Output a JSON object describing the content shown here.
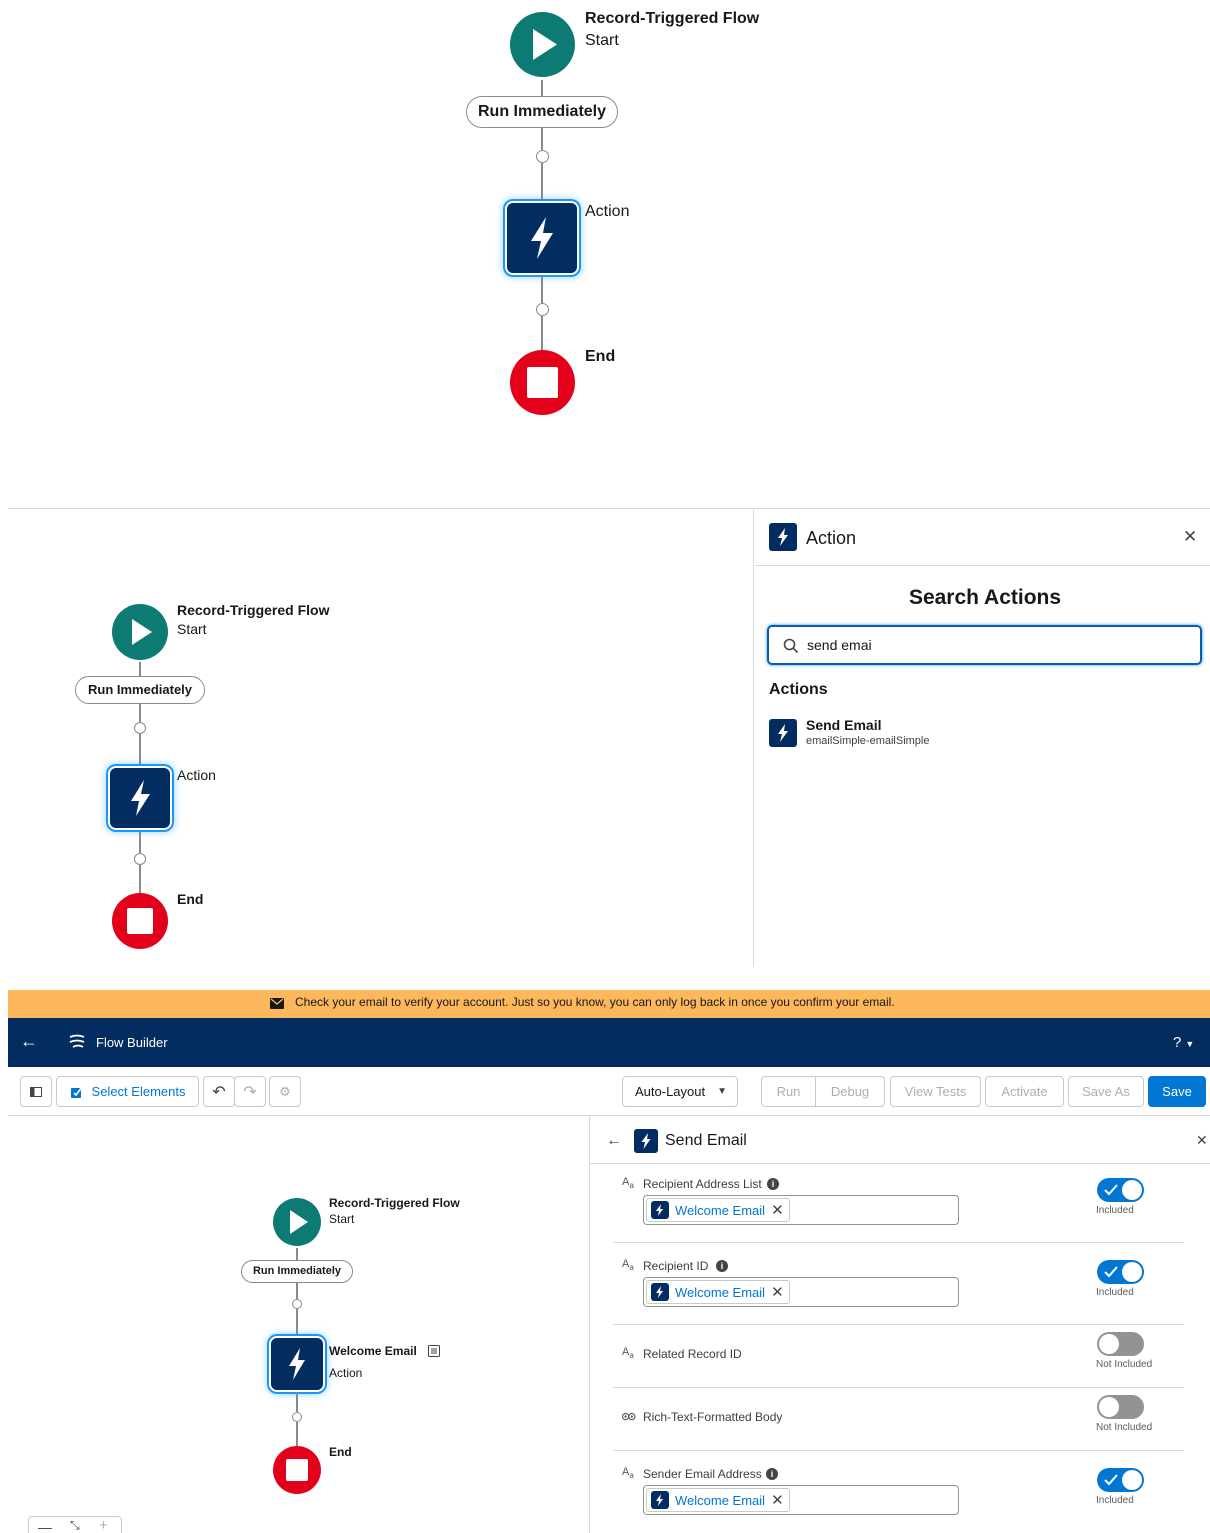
{
  "flow": {
    "start_title": "Record-Triggered Flow",
    "start_sub": "Start",
    "run_immediately": "Run Immediately",
    "action_label": "Action",
    "end_label": "End",
    "action_named": "Welcome Email"
  },
  "action_panel": {
    "title": "Action",
    "close": "✕",
    "search_heading": "Search Actions",
    "search_value": "send emai",
    "section": "Actions",
    "result_name": "Send Email",
    "result_api": "emailSimple-emailSimple"
  },
  "banner": {
    "text": "Check your email to verify your account. Just so you know, you can only log back in once you confirm your email."
  },
  "header": {
    "back": "←",
    "app_name": "Flow Builder",
    "help": "?"
  },
  "toolbar": {
    "select_elements": "Select Elements",
    "layout_select": "Auto-Layout",
    "run": "Run",
    "debug": "Debug",
    "view_tests": "View Tests",
    "activate": "Activate",
    "save_as": "Save As",
    "save": "Save"
  },
  "send_email_panel": {
    "back": "←",
    "title": "Send Email",
    "close": "✕",
    "rows": [
      {
        "label": "Recipient Address List",
        "chip": "Welcome Email",
        "status": "Included",
        "on": true
      },
      {
        "label": "Recipient ID",
        "chip": "Welcome Email",
        "status": "Included",
        "on": true
      },
      {
        "label": "Related Record ID",
        "status": "Not Included",
        "on": false
      },
      {
        "label": "Rich-Text-Formatted Body",
        "status": "Not Included",
        "on": false
      },
      {
        "label": "Sender Email Address",
        "chip": "Welcome Email",
        "status": "Included",
        "on": true
      }
    ]
  },
  "colors": {
    "start": "#0d7a73",
    "end": "#e3001b",
    "action": "#032d60",
    "brand": "#0176d3",
    "banner": "#fdb75d",
    "header": "#032d60"
  }
}
